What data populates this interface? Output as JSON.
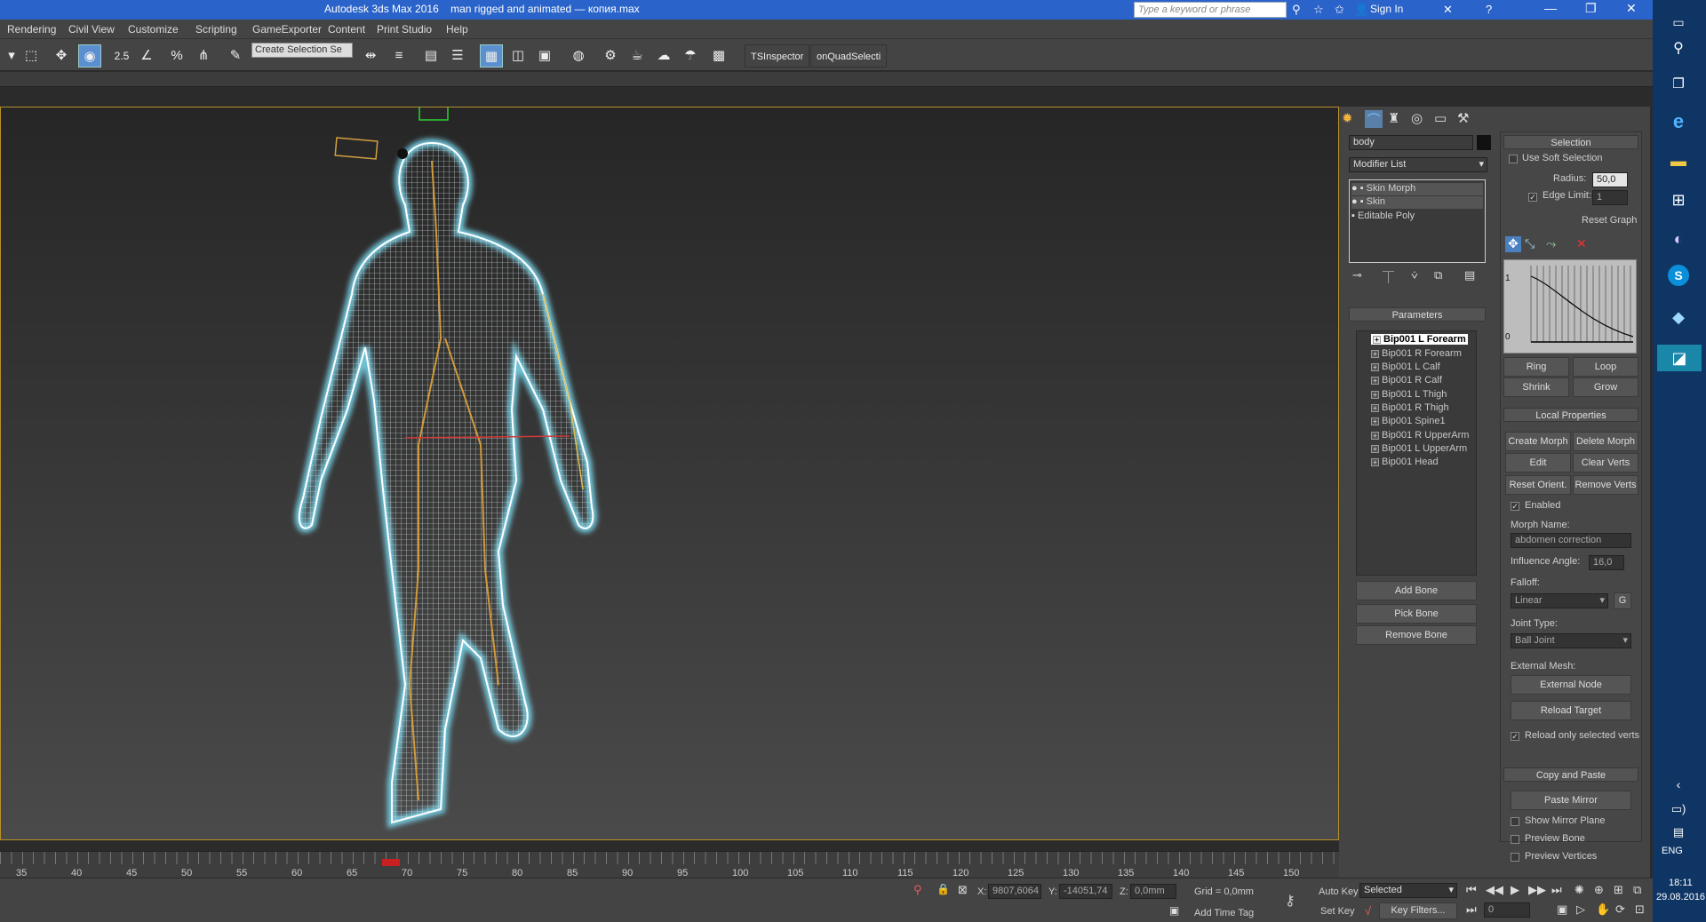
{
  "titlebar": {
    "app": "Autodesk 3ds Max 2016",
    "file": "man rigged and animated — копия.max",
    "search_placeholder": "Type a keyword or phrase",
    "sign_in": "Sign In"
  },
  "menu": [
    "Rendering",
    "Civil View",
    "Customize",
    "Scripting",
    "GameExporter",
    "Content",
    "Print Studio",
    "Help"
  ],
  "toolbar": {
    "snap_label": "2.5",
    "selection_set_placeholder": "Create Selection Se",
    "ts_inspector": "TSInspector",
    "quad_select": "onQuadSelecti"
  },
  "panel": {
    "object_name": "body",
    "modifier_list": "Modifier List",
    "modifiers": [
      "Skin Morph",
      "Skin",
      "Editable Poly"
    ],
    "parameters_title": "Parameters",
    "bones": [
      "Bip001 L Forearm",
      "Bip001 R Forearm",
      "Bip001 L Calf",
      "Bip001 R Calf",
      "Bip001 L Thigh",
      "Bip001 R Thigh",
      "Bip001 Spine1",
      "Bip001 R UpperArm",
      "Bip001 L UpperArm",
      "Bip001 Head"
    ],
    "add_bone": "Add Bone",
    "pick_bone": "Pick Bone",
    "remove_bone": "Remove Bone",
    "selection_title": "Selection",
    "use_soft_selection": "Use Soft Selection",
    "radius_label": "Radius:",
    "radius_value": "50,0",
    "edge_limit_label": "Edge Limit:",
    "edge_limit_value": "1",
    "reset_graph": "Reset Graph",
    "graph_top": "1",
    "graph_bottom": "0",
    "ring": "Ring",
    "loop": "Loop",
    "shrink": "Shrink",
    "grow": "Grow",
    "local_props_title": "Local Properties",
    "create_morph": "Create Morph",
    "delete_morph": "Delete Morph",
    "edit": "Edit",
    "clear_verts": "Clear Verts",
    "reset_orient": "Reset Orient.",
    "remove_verts": "Remove Verts",
    "enabled": "Enabled",
    "morph_name_label": "Morph Name:",
    "morph_name_value": "abdomen correction",
    "influence_angle_label": "Influence Angle:",
    "influence_angle_value": "16,0",
    "falloff_label": "Falloff:",
    "falloff_value": "Linear",
    "falloff_g": "G",
    "joint_type_label": "Joint Type:",
    "joint_type_value": "Ball Joint",
    "external_mesh_label": "External Mesh:",
    "external_node": "External Node",
    "reload_target": "Reload Target",
    "reload_only": "Reload only selected verts",
    "copy_paste_title": "Copy and Paste",
    "paste_mirror": "Paste Mirror",
    "show_mirror_plane": "Show Mirror Plane",
    "preview_bone": "Preview Bone",
    "preview_vertices": "Preview Vertices"
  },
  "timeline": {
    "ticks": [
      "35",
      "40",
      "45",
      "50",
      "55",
      "60",
      "65",
      "70",
      "75",
      "80",
      "85",
      "90",
      "95",
      "100",
      "105",
      "110",
      "115",
      "120",
      "125",
      "130",
      "135",
      "140",
      "145",
      "150"
    ]
  },
  "status": {
    "x_label": "X:",
    "x_value": "9807,6064",
    "y_label": "Y:",
    "y_value": "-14051,74",
    "z_label": "Z:",
    "z_value": "0,0mm",
    "grid": "Grid = 0,0mm",
    "add_time_tag": "Add Time Tag",
    "auto_key": "Auto Key",
    "set_key": "Set Key",
    "selected": "Selected",
    "key_filters": "Key Filters...",
    "frame": "0"
  },
  "taskbar": {
    "lang": "ENG",
    "time": "18:11",
    "date": "29.08.2016"
  }
}
